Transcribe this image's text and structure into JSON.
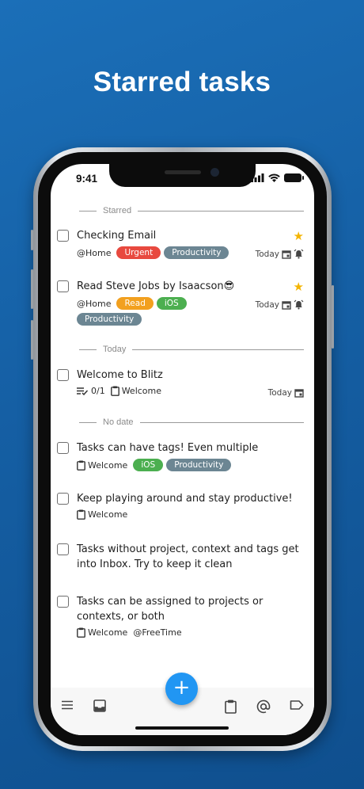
{
  "headline": "Starred tasks",
  "status_bar": {
    "time": "9:41"
  },
  "sections": [
    {
      "label": "Starred"
    },
    {
      "label": "Today"
    },
    {
      "label": "No date"
    }
  ],
  "tasks": [
    {
      "title": "Checking Email",
      "context": "@Home",
      "tags": [
        {
          "label": "Urgent",
          "color": "#e8493f"
        },
        {
          "label": "Productivity",
          "color": "#6c8693"
        }
      ],
      "due": "Today",
      "starred": true
    },
    {
      "title": "Read Steve Jobs by Isaacson😎",
      "context": "@Home",
      "tags": [
        {
          "label": "Read",
          "color": "#f2a01f"
        },
        {
          "label": "iOS",
          "color": "#4caf50"
        },
        {
          "label": "Productivity",
          "color": "#6c8693"
        }
      ],
      "due": "Today",
      "starred": true
    },
    {
      "title": "Welcome to Blitz",
      "subtasks": "0/1",
      "project": "Welcome",
      "due": "Today"
    },
    {
      "title": "Tasks can have tags! Even multiple",
      "project": "Welcome",
      "tags": [
        {
          "label": "iOS",
          "color": "#4caf50"
        },
        {
          "label": "Productivity",
          "color": "#6c8693"
        }
      ]
    },
    {
      "title": "Keep playing around and stay productive!",
      "project": "Welcome"
    },
    {
      "title": "Tasks without project, context and tags get into Inbox. Try to keep it clean"
    },
    {
      "title": "Tasks can be assigned to projects or contexts, or both",
      "project": "Welcome",
      "context": "@FreeTime"
    }
  ],
  "fab_label": "+",
  "colors": {
    "accent": "#2196f3",
    "background": "#155fa4",
    "star": "#f4b400"
  },
  "bottom_nav": [
    "menu-icon",
    "inbox-icon",
    "clipboard-icon",
    "at-icon",
    "tag-icon"
  ]
}
